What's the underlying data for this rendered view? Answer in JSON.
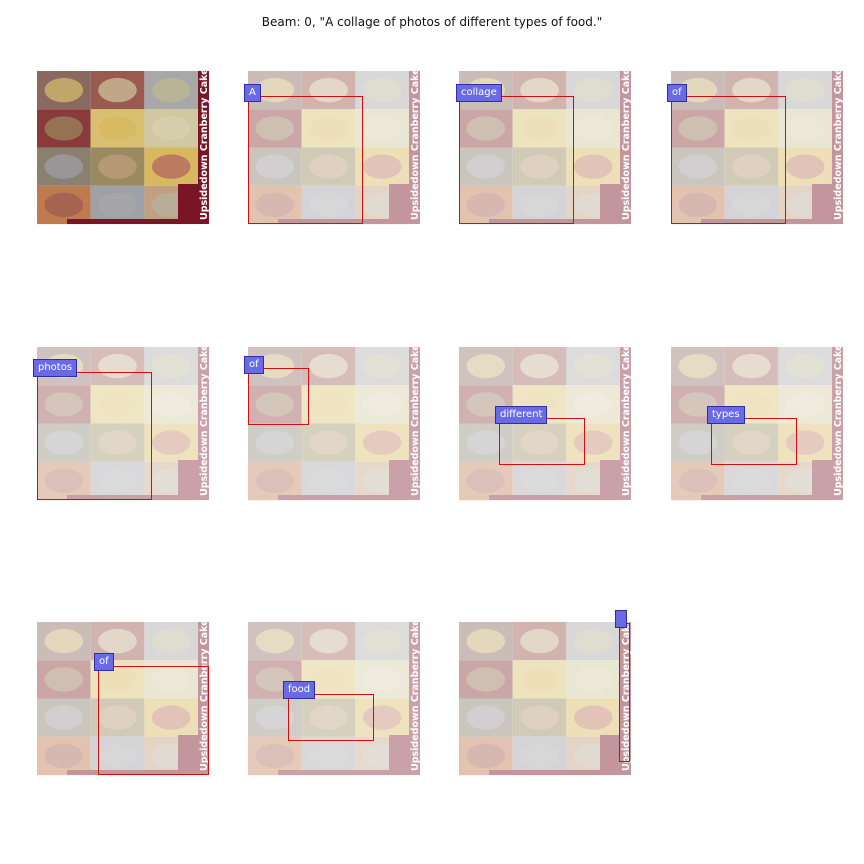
{
  "figure": {
    "title": "Beam: 0, \"A collage of photos of different types of food.\""
  },
  "image": {
    "side_text": "Upsidedown Cranberry Cake"
  },
  "panels": [
    {
      "token": "",
      "dim": 0.0
    },
    {
      "token": "A",
      "dim": 0.55
    },
    {
      "token": "collage",
      "dim": 0.55
    },
    {
      "token": "of",
      "dim": 0.55
    },
    {
      "token": "photos",
      "dim": 0.6
    },
    {
      "token": "of",
      "dim": 0.6
    },
    {
      "token": "different",
      "dim": 0.6
    },
    {
      "token": "types",
      "dim": 0.6
    },
    {
      "token": "of",
      "dim": 0.55
    },
    {
      "token": "food",
      "dim": 0.6
    },
    {
      "token": "",
      "dim": 0.55
    }
  ],
  "colors": {
    "box": "#cc1111",
    "label_bg": "#6a6ae6",
    "strip": "#7a1526"
  }
}
